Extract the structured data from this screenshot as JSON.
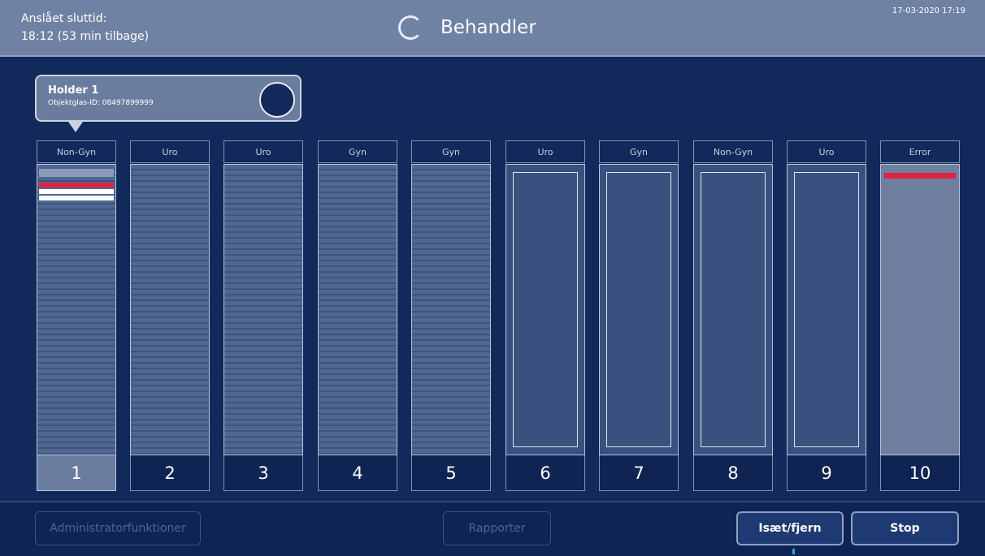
{
  "header": {
    "estimate_label": "Anslået sluttid:",
    "estimate_value": "18:12 (53 min tilbage)",
    "status_title": "Behandler",
    "datetime": "17-03-2020 17:19"
  },
  "tooltip": {
    "title": "Holder 1",
    "subtitle": "Objektglas-ID: 08497899999"
  },
  "holders": [
    {
      "number": "1",
      "label": "Non-Gyn",
      "state": "filled",
      "selected": true
    },
    {
      "number": "2",
      "label": "Uro",
      "state": "filled",
      "selected": false
    },
    {
      "number": "3",
      "label": "Uro",
      "state": "filled",
      "selected": false
    },
    {
      "number": "4",
      "label": "Gyn",
      "state": "filled",
      "selected": false
    },
    {
      "number": "5",
      "label": "Gyn",
      "state": "filled",
      "selected": false
    },
    {
      "number": "6",
      "label": "Uro",
      "state": "empty",
      "selected": false
    },
    {
      "number": "7",
      "label": "Gyn",
      "state": "empty",
      "selected": false
    },
    {
      "number": "8",
      "label": "Non-Gyn",
      "state": "empty",
      "selected": false
    },
    {
      "number": "9",
      "label": "Uro",
      "state": "empty",
      "selected": false
    },
    {
      "number": "10",
      "label": "Error",
      "state": "error",
      "selected": false
    }
  ],
  "footer": {
    "admin_label": "Administratorfunktioner",
    "reports_label": "Rapporter",
    "insert_remove_label": "Isæt/fjern",
    "stop_label": "Stop"
  },
  "colors": {
    "background": "#11295b",
    "header": "#6f82a3",
    "error_stripe": "#e0213f",
    "highlight_stripe": "#ffffff"
  },
  "icons": {
    "status": "loading-spinner-icon"
  }
}
